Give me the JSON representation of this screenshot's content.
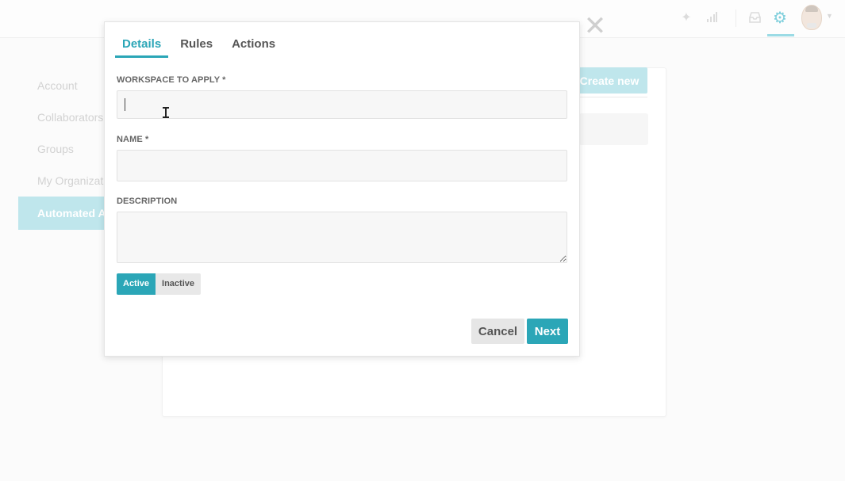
{
  "topbar": {
    "icons": [
      "sparkle-icon",
      "signal-bars-icon",
      "inbox-icon",
      "gear-icon",
      "avatar",
      "chevron-down-icon"
    ]
  },
  "sidebar": {
    "items": [
      {
        "label": "Account"
      },
      {
        "label": "Collaborators"
      },
      {
        "label": "Groups"
      },
      {
        "label": "My Organizat"
      },
      {
        "label": "Automated A"
      }
    ]
  },
  "background": {
    "create_button": "Create new"
  },
  "modal": {
    "close_symbol": "✕",
    "tabs": [
      {
        "label": "Details"
      },
      {
        "label": "Rules"
      },
      {
        "label": "Actions"
      }
    ],
    "workspace": {
      "label": "WORKSPACE TO APPLY *",
      "value": ""
    },
    "name": {
      "label": "NAME *",
      "value": ""
    },
    "description": {
      "label": "DESCRIPTION",
      "value": ""
    },
    "status": {
      "active_label": "Active",
      "inactive_label": "Inactive",
      "selected": "Active"
    },
    "cancel_label": "Cancel",
    "next_label": "Next"
  },
  "colors": {
    "accent": "#2ba6b7",
    "accent_faded": "#bfe6ec"
  }
}
